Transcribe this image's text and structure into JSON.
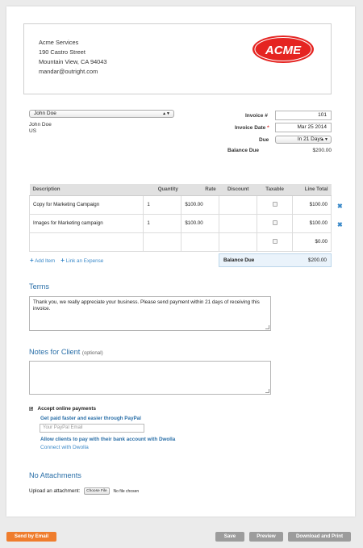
{
  "company": {
    "name": "Acme Services",
    "street": "190 Castro Street",
    "city": "Mountain View, CA 94043",
    "email": "mandar@outright.com",
    "logo_text": "ACME"
  },
  "client": {
    "selected": "John Doe",
    "name": "John Doe",
    "country": "US"
  },
  "invoice": {
    "number_label": "Invoice #",
    "number_value": "101",
    "date_label": "Invoice Date",
    "date_required": "*",
    "date_value": "Mar 25 2014",
    "due_label": "Due",
    "due_value": "In 21 Days",
    "balance_label": "Balance Due",
    "balance_value": "$200.00"
  },
  "table": {
    "headers": [
      "Description",
      "Quantity",
      "Rate",
      "Discount",
      "Taxable",
      "Line Total"
    ],
    "rows": [
      {
        "description": "Copy for Marketing Campaign",
        "quantity": "1",
        "rate": "$100.00",
        "discount": "",
        "line_total": "$100.00"
      },
      {
        "description": "Images for Marketing campaign",
        "quantity": "1",
        "rate": "$100.00",
        "discount": "",
        "line_total": "$100.00"
      },
      {
        "description": "",
        "quantity": "",
        "rate": "",
        "discount": "",
        "line_total": "$0.00"
      }
    ],
    "add_item": "Add Item",
    "link_expense": "Link an Expense",
    "balance_label": "Balance Due",
    "balance_value": "$200.00"
  },
  "terms": {
    "title": "Terms",
    "text": "Thank you, we really appreciate your business. Please send payment within 21 days of receiving this invoice."
  },
  "notes": {
    "title": "Notes for Client",
    "optional": "(optional)",
    "text": ""
  },
  "payments": {
    "accept_label": "Accept online payments",
    "paypal_title": "Get paid faster and easier through PayPal",
    "paypal_placeholder": "Your PayPal Email",
    "dwolla_title": "Allow clients to pay with their bank account with Dwolla",
    "dwolla_link": "Connect with Dwolla"
  },
  "attachments": {
    "title": "No Attachments",
    "upload_label": "Upload an attachment:",
    "choose_button": "Choose File",
    "file_status": "No file chosen"
  },
  "actions": {
    "send_email": "Send by Email",
    "save": "Save",
    "preview": "Preview",
    "download_print": "Download and Print"
  },
  "colors": {
    "accent_orange": "#ef7d2d",
    "link_blue": "#3a89c9",
    "heading_blue": "#2a6fa8",
    "logo_red": "#e52421"
  }
}
